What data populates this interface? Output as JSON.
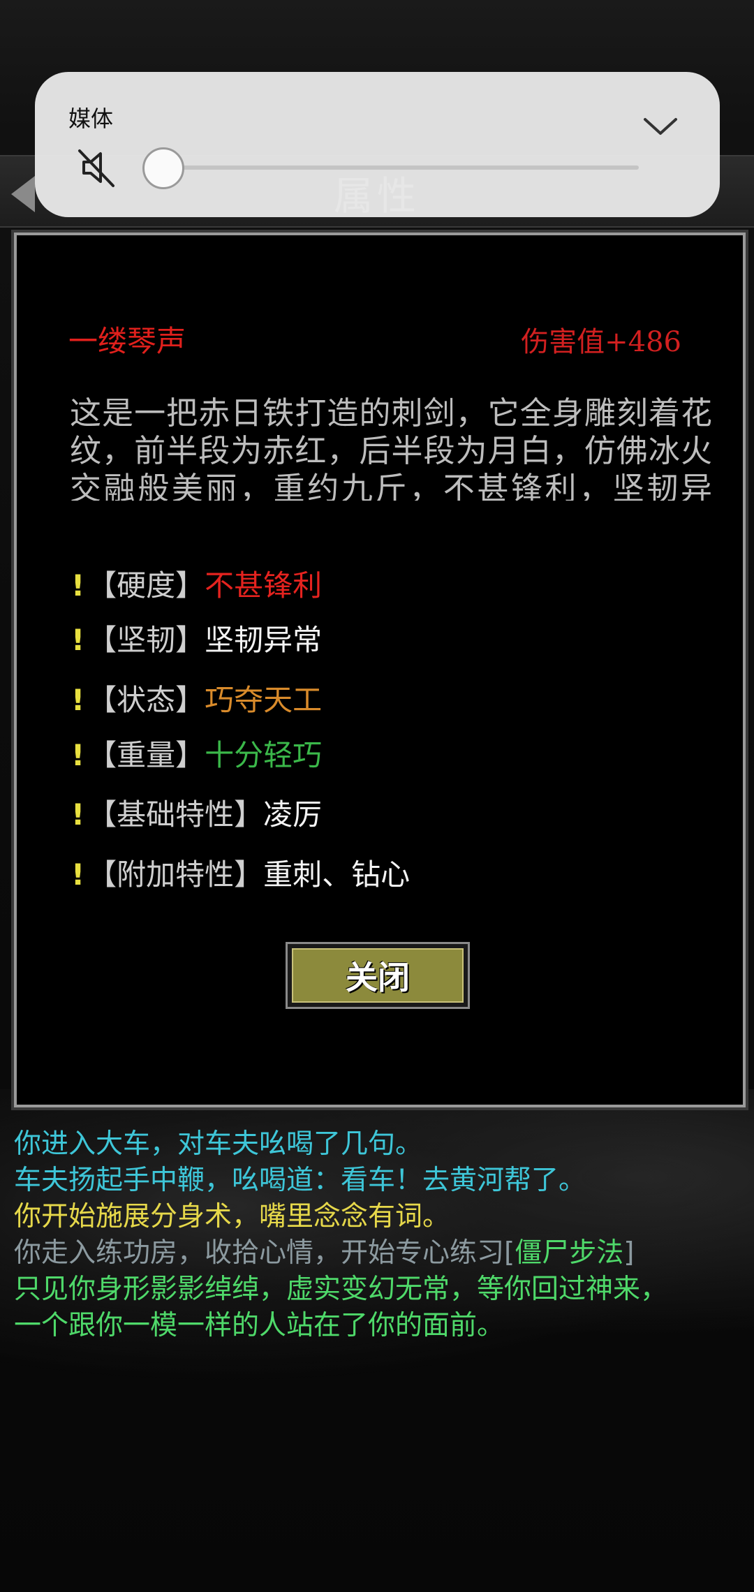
{
  "header": {
    "title": "属性"
  },
  "media": {
    "label": "媒体",
    "volume_fraction": 0.0
  },
  "item": {
    "name": "一缕琴声",
    "damage": "伤害值+486",
    "description": "这是一把赤日铁打造的刺剑，它全身雕刻着花纹，前半段为赤红，后半段为月白，仿佛冰火交融般美丽，重约九斤，不甚锋利，坚韧异常，攻势凌厉，令人心生畏惧，若是刺"
  },
  "attributes": [
    {
      "mark": "!",
      "key": "【硬度】",
      "value": "不甚锋利",
      "color": "#e5231f"
    },
    {
      "mark": "!",
      "key": "【坚韧】",
      "value": "坚韧异常",
      "color": "#f4f4f4"
    },
    {
      "mark": "!",
      "key": "【状态】",
      "value": "巧夺天工",
      "color": "#d98b2b"
    },
    {
      "mark": "!",
      "key": "【重量】",
      "value": "十分轻巧",
      "color": "#3bb84a"
    },
    {
      "mark": "!",
      "key": "【基础特性】",
      "value": "凌厉",
      "color": "#f4f4f4"
    },
    {
      "mark": "!",
      "key": "【附加特性】",
      "value": "重刺、钻心",
      "color": "#f4f4f4"
    }
  ],
  "close_button": {
    "label": "关闭"
  },
  "log": [
    {
      "text": "你进入大车，对车夫吆喝了几句。",
      "color": "#3ec6d8"
    },
    {
      "text": "车夫扬起手中鞭，吆喝道：看车！去黄河帮了。",
      "color": "#3ec6d8"
    },
    {
      "text": "你开始施展分身术，嘴里念念有词。",
      "color": "#e6d84a"
    },
    {
      "text_prefix": "你走入练功房，收拾心情，开始专心练习[",
      "skill": "僵尸步法",
      "text_suffix": "]",
      "color": "#8c9aa0",
      "skill_color": "#4fd96a"
    },
    {
      "text": "只见你身形影影绰绰，虚实变幻无常，等你回过神来，",
      "color": "#4fd96a"
    },
    {
      "text": "一个跟你一模一样的人站在了你的面前。",
      "color": "#4fd96a"
    }
  ]
}
